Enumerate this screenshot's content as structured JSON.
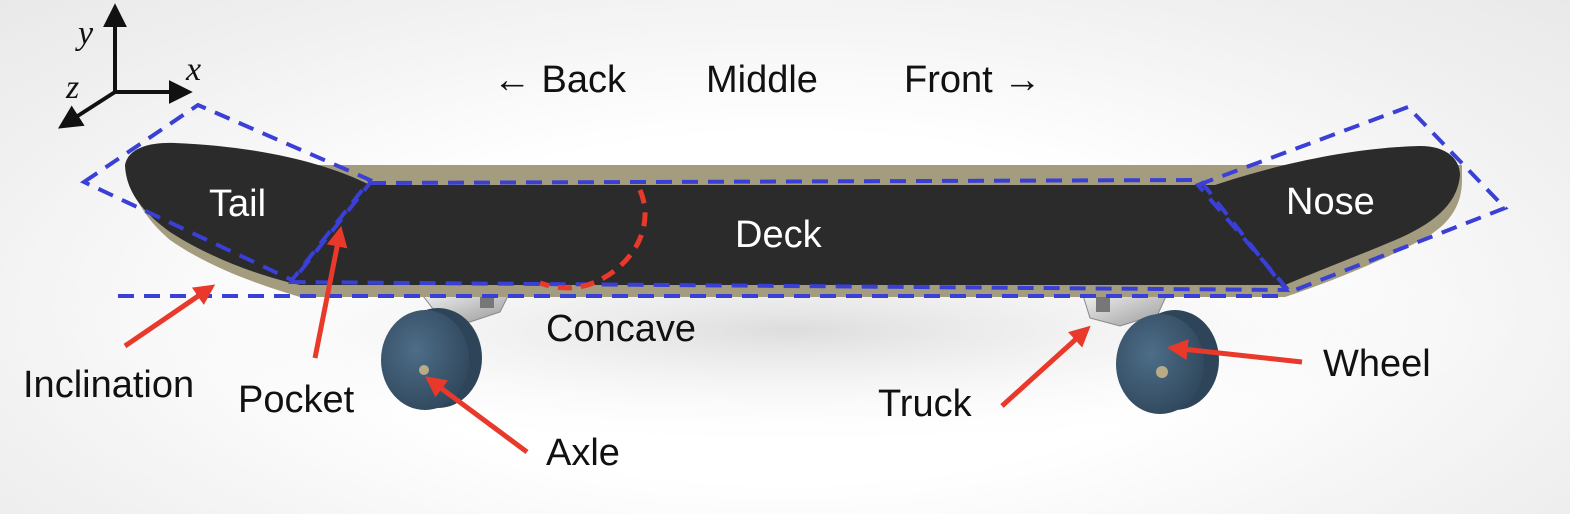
{
  "axes": {
    "x": "x",
    "y": "y",
    "z": "z"
  },
  "directions": {
    "back": "← Back",
    "middle": "Middle",
    "front": "Front →"
  },
  "regions": {
    "tail": "Tail",
    "deck": "Deck",
    "nose": "Nose"
  },
  "callouts": {
    "inclination": "Inclination",
    "pocket": "Pocket",
    "concave": "Concave",
    "axle": "Axle",
    "truck": "Truck",
    "wheel": "Wheel"
  },
  "colors": {
    "deck_top": "#2b2b2b",
    "deck_edge": "#a49c7e",
    "wheel": "#3f5d77",
    "arrow": "#e8392a",
    "region_outline": "#3a3fd6",
    "concave_outline": "#e8392a"
  }
}
